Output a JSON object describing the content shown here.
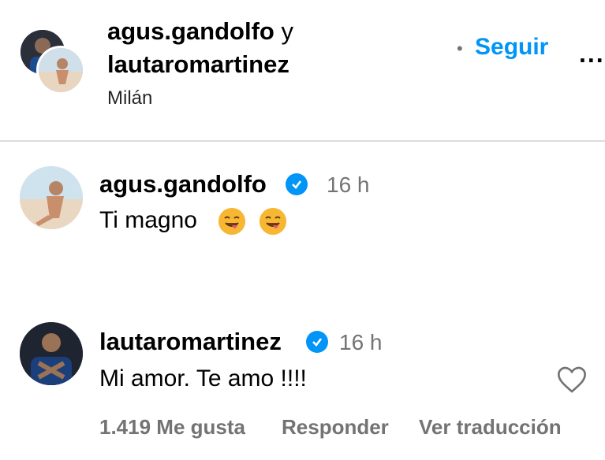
{
  "post_header": {
    "author1": "agus.gandolfo",
    "conjunction": "y",
    "author2": "lautaromartinez",
    "location": "Milán",
    "follow_dot": "•",
    "follow_label": "Seguir",
    "more_label": "..."
  },
  "comments": [
    {
      "username": "agus.gandolfo",
      "verified": true,
      "time": "16 h",
      "text": "Ti magno",
      "emoji_icons": [
        "face-savoring-food-icon",
        "face-savoring-food-icon"
      ]
    },
    {
      "username": "lautaromartinez",
      "verified": true,
      "time": "16 h",
      "text": "Mi amor. Te amo !!!!",
      "likes": "1.419 Me gusta",
      "reply_label": "Responder",
      "translate_label": "Ver traducción"
    }
  ],
  "colors": {
    "accent": "#0095f6",
    "muted": "#737373",
    "divider": "#dbdbdb"
  }
}
